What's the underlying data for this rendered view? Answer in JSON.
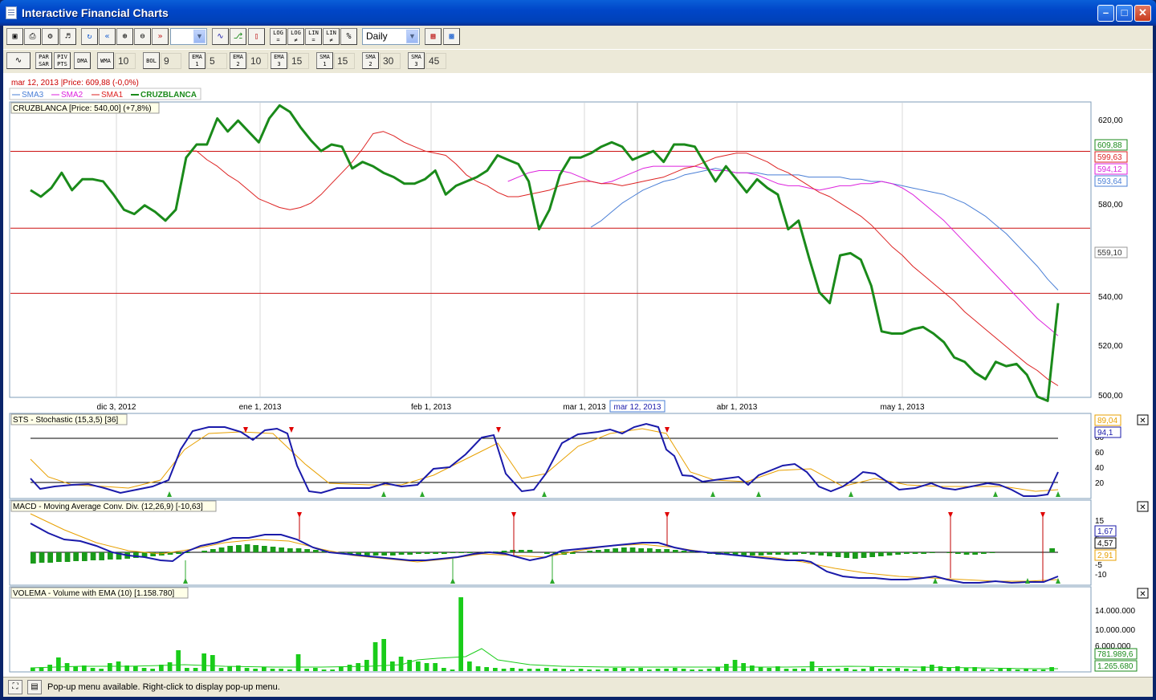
{
  "window": {
    "title": "Interactive Financial Charts",
    "minimize": "–",
    "maximize": "□",
    "close": "✕"
  },
  "toolbar1": {
    "buttons": [
      "new-chart",
      "print",
      "settings",
      "sound",
      "refresh",
      "scroll-back",
      "zoom-in",
      "zoom-out",
      "scroll-forward"
    ],
    "chart_types": [
      "line",
      "bar",
      "candle"
    ],
    "scale_buttons": [
      {
        "id": "log-eq",
        "top": "LOG",
        "bottom": "="
      },
      {
        "id": "log-neq",
        "top": "LOG",
        "bottom": "≠"
      },
      {
        "id": "lin-eq",
        "top": "LIN",
        "bottom": "="
      },
      {
        "id": "lin-neq",
        "top": "LIN",
        "bottom": "≠"
      },
      {
        "id": "percent",
        "top": "%",
        "bottom": ""
      }
    ],
    "blank_select": "",
    "period_select": "Daily"
  },
  "toolbar2": {
    "indicators": [
      {
        "id": "par-sar",
        "label": "PAR SAR",
        "value": ""
      },
      {
        "id": "pivot-points",
        "label": "PIV PTS",
        "value": ""
      },
      {
        "id": "dma",
        "label": "DMA",
        "value": ""
      },
      {
        "id": "wma",
        "label": "WMA",
        "value": "10"
      },
      {
        "id": "bol",
        "label": "BOL",
        "value": "9"
      },
      {
        "id": "ema1",
        "label": "EMA 1",
        "value": "5"
      },
      {
        "id": "ema2",
        "label": "EMA 2",
        "value": "10"
      },
      {
        "id": "ema3",
        "label": "EMA 3",
        "value": "15"
      },
      {
        "id": "sma1",
        "label": "SMA 1",
        "value": "15"
      },
      {
        "id": "sma2",
        "label": "SMA 2",
        "value": "30"
      },
      {
        "id": "sma3",
        "label": "SMA 3",
        "value": "45"
      }
    ]
  },
  "price_panel": {
    "cursor_info": "mar 12, 2013 |Price: 609,88 (-0,0%)",
    "legend": [
      {
        "name": "SMA3",
        "color": "#4a7fd6"
      },
      {
        "name": "SMA2",
        "color": "#dd22dd"
      },
      {
        "name": "SMA1",
        "color": "#dd2222"
      },
      {
        "name": "CRUZBLANCA",
        "color": "#1a8a1a"
      }
    ],
    "title": "CRUZBLANCA [Price: 540,00] (+7,8%)",
    "y_ticks": [
      "620,00",
      "580,00",
      "540,00",
      "520,00",
      "500,00"
    ],
    "y_label_boxes": [
      {
        "text": "609,88",
        "color": "#1a8a1a"
      },
      {
        "text": "599,63",
        "color": "#dd2222"
      },
      {
        "text": "594,12",
        "color": "#dd22dd"
      },
      {
        "text": "593,64",
        "color": "#4a7fd6"
      }
    ],
    "h_line_box": "559,10",
    "x_ticks": [
      "dic 3, 2012",
      "ene 1, 2013",
      "feb 1, 2013",
      "mar 1, 2013",
      "abr 1, 2013",
      "may 1, 2013"
    ],
    "cursor_date": "mar 12, 2013"
  },
  "stochastic_panel": {
    "title": "STS - Stochastic (15,3,5) [36]",
    "y_ticks": [
      "80",
      "60",
      "40",
      "20"
    ],
    "value_boxes": [
      {
        "text": "89,04",
        "color": "#e8a000"
      },
      {
        "text": "94,1",
        "color": "#1a1aaa"
      }
    ]
  },
  "macd_panel": {
    "title": "MACD - Moving Average Conv. Div. (12,26,9) [-10,63]",
    "y_ticks": [
      "15",
      "5",
      "-5",
      "-10"
    ],
    "value_boxes": [
      {
        "text": "1,67",
        "color": "#1a1aaa"
      },
      {
        "text": "4,57",
        "color": "#000000"
      },
      {
        "text": "2,91",
        "color": "#e8a000"
      }
    ]
  },
  "volume_panel": {
    "title": "VOLEMA - Volume with EMA (10) [1.158.780]",
    "y_ticks": [
      "14.000.000",
      "10.000.000",
      "6.000.000"
    ],
    "value_boxes": [
      {
        "text": "781.989,6",
        "color": "#1a8a1a"
      },
      {
        "text": "1.265.680",
        "color": "#1a8a1a"
      }
    ]
  },
  "panel_close": "✕",
  "status": {
    "message": "Pop-up menu available. Right-click to display pop-up menu."
  },
  "chart_data": {
    "type": "line",
    "title": "CRUZBLANCA [Price: 540,00] (+7,8%)",
    "y_range": [
      497,
      630
    ],
    "horizontal_lines": [
      609.88,
      574.5,
      544.5
    ],
    "series": [
      {
        "name": "CRUZBLANCA",
        "color": "#1a8a1a",
        "values": [
          592,
          589,
          593,
          600,
          592,
          597,
          597,
          596,
          590,
          583,
          581,
          585,
          582,
          578,
          583,
          607,
          613,
          613,
          625,
          619,
          624,
          619,
          614,
          625,
          631,
          628,
          621,
          615,
          610,
          613,
          612,
          602,
          605,
          603,
          600,
          598,
          595,
          595,
          597,
          601,
          590,
          594,
          596,
          598,
          601,
          608,
          606,
          604,
          596,
          574,
          583,
          599,
          607,
          607,
          609,
          612,
          614,
          612,
          606,
          608,
          610,
          605,
          613,
          613,
          612,
          604,
          596,
          603,
          597,
          591,
          597,
          593,
          590,
          574,
          578,
          561,
          545,
          540,
          562,
          563,
          560,
          548,
          527,
          526,
          526,
          528,
          529,
          526,
          522,
          515,
          513,
          508,
          505,
          513,
          511,
          512,
          507,
          497,
          495,
          540
        ]
      },
      {
        "name": "SMA1",
        "color": "#dd2222",
        "values": [
          610,
          610,
          606,
          603,
          599,
          596,
          592,
          588,
          586,
          584,
          583,
          584,
          586,
          590,
          595,
          600,
          605,
          611,
          618,
          619,
          617,
          614,
          612,
          610,
          609,
          608,
          604,
          599,
          596,
          594,
          591,
          589,
          589,
          590,
          591,
          592,
          594,
          595,
          596,
          596,
          595,
          595,
          594,
          595,
          596,
          597,
          598,
          600,
          602,
          603,
          605,
          607,
          608,
          609,
          609,
          607,
          605,
          602,
          600,
          597,
          594,
          591,
          589,
          586,
          583,
          580,
          576,
          571,
          566,
          562,
          557,
          553,
          549,
          545,
          541,
          536,
          532,
          528,
          524,
          520,
          516,
          512,
          509,
          505,
          502
        ]
      },
      {
        "name": "SMA2",
        "color": "#dd22dd",
        "values": [
          596,
          598,
          600,
          601,
          601,
          601,
          600,
          598,
          596,
          595,
          596,
          598,
          600,
          602,
          603,
          603,
          603,
          603,
          603,
          602,
          601,
          601,
          600,
          600,
          599,
          597,
          595,
          594,
          594,
          593,
          592,
          593,
          594,
          594,
          595,
          595,
          596,
          595,
          593,
          590,
          586,
          582,
          578,
          573,
          568,
          563,
          558,
          553,
          548,
          543,
          538,
          533,
          529,
          525
        ]
      },
      {
        "name": "SMA3",
        "color": "#4a7fd6",
        "values": [
          575,
          578,
          582,
          586,
          589,
          592,
          594,
          596,
          597,
          599,
          600,
          601,
          602,
          601,
          600,
          600,
          600,
          599,
          599,
          599,
          599,
          598,
          598,
          598,
          598,
          597,
          597,
          596,
          596,
          595,
          594,
          593,
          592,
          591,
          590,
          588,
          586,
          583,
          580,
          576,
          572,
          567,
          562,
          557,
          551,
          546
        ]
      }
    ]
  }
}
